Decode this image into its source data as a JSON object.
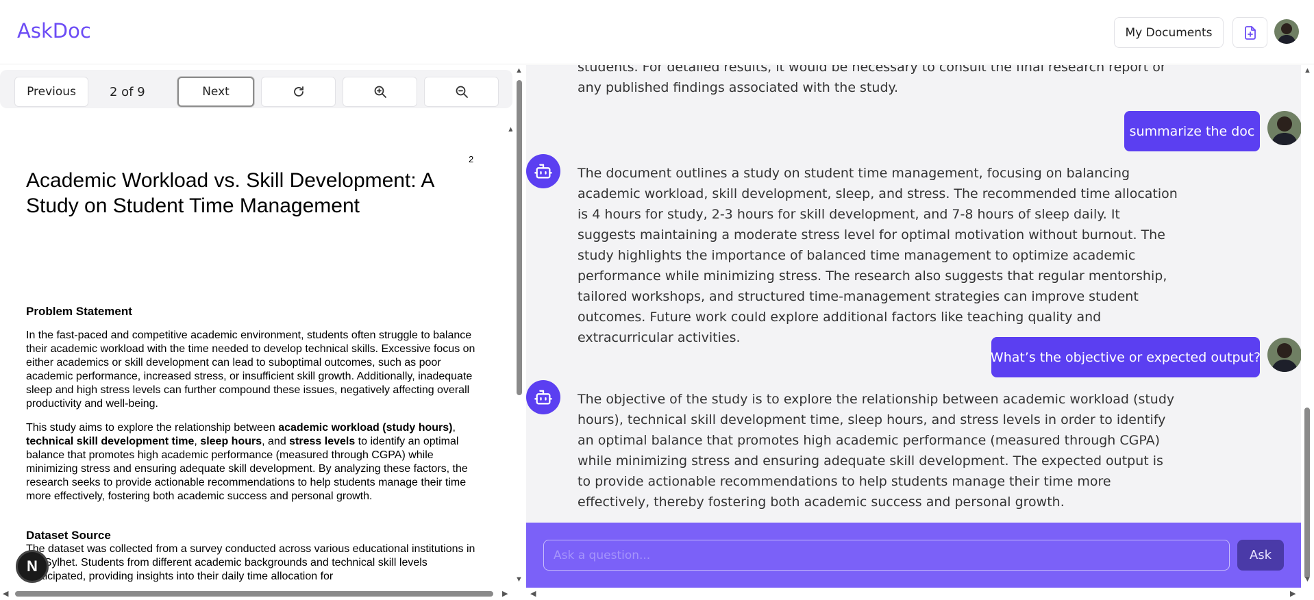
{
  "header": {
    "logo": "AskDoc",
    "my_documents_label": "My Documents",
    "upload_icon": "file-plus-icon"
  },
  "viewer": {
    "toolbar": {
      "previous_label": "Previous",
      "page_indicator": "2 of 9",
      "next_label": "Next",
      "rotate_icon": "rotate-icon",
      "zoom_in_icon": "zoom-in-icon",
      "zoom_out_icon": "zoom-out-icon"
    },
    "page_number": "2",
    "title": "Academic Workload vs. Skill Development: A Study on Student Time Management",
    "problem_heading": "Problem Statement",
    "problem_text": "In the fast-paced and competitive academic environment, students often struggle to balance their academic workload with the time needed to develop technical skills. Excessive focus on either academics or skill development can lead to suboptimal outcomes, such as poor academic performance, increased stress, or insufficient skill growth. Additionally, inadequate sleep and high stress levels can further compound these issues, negatively affecting overall productivity and well-being.",
    "aim_parts": {
      "p1": "This study aims to explore the relationship between ",
      "b1": "academic workload (study hours)",
      "p2": ", ",
      "b2": "technical skill development time",
      "p3": ", ",
      "b3": "sleep hours",
      "p4": ", and ",
      "b4": "stress levels",
      "p5": " to identify an optimal balance that promotes high academic performance (measured through CGPA) while minimizing stress and ensuring adequate skill development. By analyzing these factors, the research seeks to provide actionable recommendations to help students manage their time more effectively, fostering both academic success and personal growth."
    },
    "dataset_heading": "Dataset Source",
    "dataset_text": "The dataset was collected from a survey conducted across various educational institutions in the Sylhet. Students from different academic backgrounds and technical skill levels participated, providing insights into their daily time allocation for"
  },
  "chat": {
    "messages": [
      {
        "role": "bot",
        "text": "students. For detailed results, it would be necessary to consult the final research report or any published findings associated with the study."
      },
      {
        "role": "user",
        "text": "summarize the doc"
      },
      {
        "role": "bot",
        "text": "The document outlines a study on student time management, focusing on balancing academic workload, skill development, sleep, and stress. The recommended time allocation is 4 hours for study, 2-3 hours for skill development, and 7-8 hours of sleep daily. It suggests maintaining a moderate stress level for optimal motivation without burnout. The study highlights the importance of balanced time management to optimize academic performance while minimizing stress. The research also suggests that regular mentorship, tailored workshops, and structured time-management strategies can improve student outcomes. Future work could explore additional factors like teaching quality and extracurricular activities."
      },
      {
        "role": "user",
        "text": "What’s the objective or expected output?"
      },
      {
        "role": "bot",
        "text": "The objective of the study is to explore the relationship between academic workload (study hours), technical skill development time, sleep hours, and stress levels in order to identify an optimal balance that promotes high academic performance (measured through CGPA) while minimizing stress and ensuring adequate skill development. The expected output is to provide actionable recommendations to help students manage their time more effectively, thereby fostering both academic success and personal growth."
      }
    ],
    "input_placeholder": "Ask a question...",
    "ask_label": "Ask"
  },
  "fab_label": "N",
  "colors": {
    "accent": "#5b3ff1",
    "input_bar": "#7b61f8",
    "logo": "#6c4cf5"
  }
}
